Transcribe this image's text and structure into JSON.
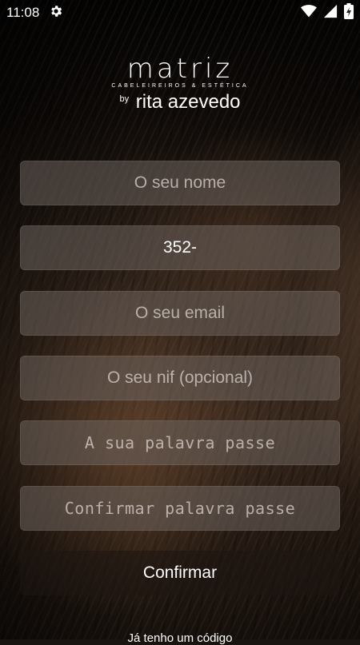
{
  "status_bar": {
    "time": "11:08",
    "icons": [
      "settings-gear-icon",
      "wifi-icon",
      "cell-signal-icon",
      "battery-charging-icon"
    ]
  },
  "logo": {
    "brand": "matriz",
    "tagline": "CABELEIREIROS & ESTÉTICA",
    "by": "by",
    "name": "rita azevedo"
  },
  "form": {
    "name": {
      "placeholder": "O seu nome",
      "value": ""
    },
    "phone": {
      "placeholder": "",
      "value": "352-"
    },
    "email": {
      "placeholder": "O seu email",
      "value": ""
    },
    "nif": {
      "placeholder": "O seu nif (opcional)",
      "value": ""
    },
    "password": {
      "placeholder": "A sua palavra passe",
      "value": ""
    },
    "confirm_password": {
      "placeholder": "Confirmar palavra passe",
      "value": ""
    },
    "confirm_button": "Confirmar"
  },
  "bottom_link": "Já tenho um código"
}
